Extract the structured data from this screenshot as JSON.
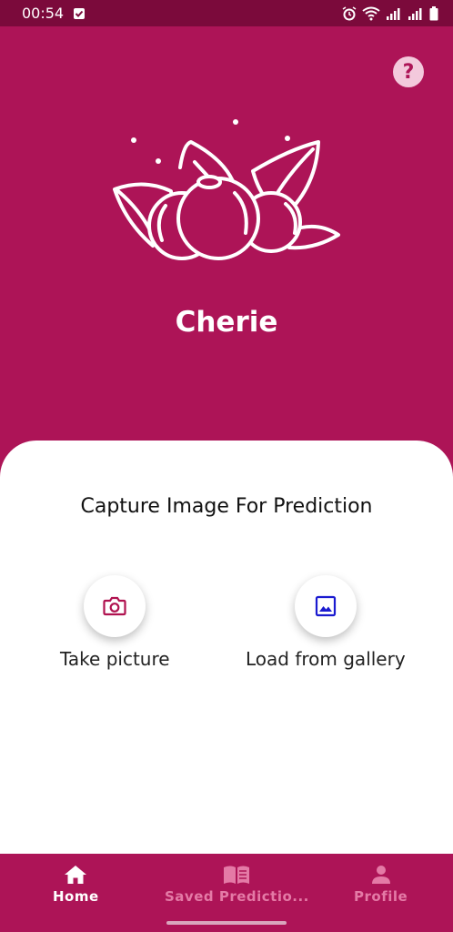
{
  "status_bar": {
    "time": "00:54"
  },
  "header": {
    "app_name": "Cherie",
    "help_symbol": "?"
  },
  "card": {
    "title": "Capture Image For Prediction",
    "take_picture_label": "Take picture",
    "load_gallery_label": "Load from gallery"
  },
  "bottom_nav": {
    "items": [
      {
        "label": "Home",
        "icon": "home-icon"
      },
      {
        "label": "Saved Predictio...",
        "icon": "book-icon"
      },
      {
        "label": "Profile",
        "icon": "person-icon"
      }
    ]
  },
  "colors": {
    "primary": "#ad1457",
    "status_bar": "#7b0a3b",
    "camera_icon": "#b0124f",
    "gallery_icon": "#1a1ad0"
  }
}
